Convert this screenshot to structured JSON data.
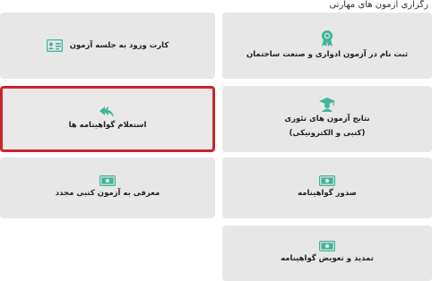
{
  "header": {
    "caption": "رگزاری آزمون های مهارتی"
  },
  "cards": {
    "register": {
      "label": "ثبت نام در آزمون ادواری و صنعت ساختمان",
      "icon": "certificate-badge-icon"
    },
    "entry_card": {
      "label": "کارت ورود به جلسه آزمون",
      "icon": "id-card-icon"
    },
    "results": {
      "label_line1": "نتایج آزمون های تئوری",
      "label_line2": "(کتبی و الکترونیکی)",
      "icon": "graduate-icon"
    },
    "inquiry": {
      "label": "استعلام گواهینامه ها",
      "icon": "reply-arrows-icon"
    },
    "issue": {
      "label": "صدور گواهینامه",
      "icon": "banknote-icon"
    },
    "reintroduce": {
      "label": "معرفی به آزمون کتبی مجدد",
      "icon": "banknote-icon"
    },
    "renew": {
      "label": "تمدید و تعویض گواهینامه",
      "icon": "banknote-icon"
    }
  },
  "colors": {
    "accent": "#3fb59a",
    "highlight_border": "#d0222d",
    "card_bg": "#e7e7e7"
  }
}
